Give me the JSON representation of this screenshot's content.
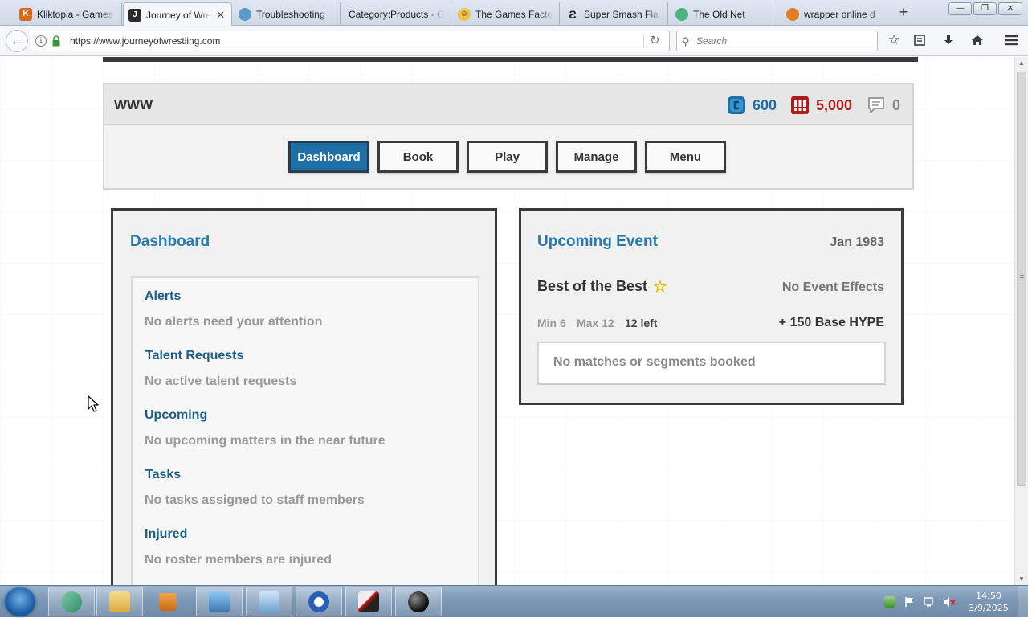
{
  "browser": {
    "tabs": [
      {
        "title": "Kliktopia - Games",
        "favicon": "kliktopia-icon",
        "color": "#d46b1e"
      },
      {
        "title": "Journey of Wrestling",
        "favicon": "jow-icon",
        "color": "#333333",
        "active": true
      },
      {
        "title": "Troubleshooting",
        "favicon": "troubleshooting-icon",
        "color": "#4a86b8"
      },
      {
        "title": "Category:Products - G",
        "favicon": "none",
        "color": "#cccccc"
      },
      {
        "title": "The Games Factory",
        "favicon": "games-factory-icon",
        "color": "#e7a626"
      },
      {
        "title": "Super Smash Flash",
        "favicon": "smash-icon",
        "color": "#222222"
      },
      {
        "title": "The Old Net",
        "favicon": "oldnet-icon",
        "color": "#3a9a6a"
      },
      {
        "title": "wrapper online d",
        "favicon": "wrapper-icon",
        "color": "#e27d2a"
      }
    ],
    "tab_close": "✕",
    "new_tab": "+",
    "url": "https://www.journeyofwrestling.com",
    "url_display": "https://www.journeyofwrestling.com",
    "search_placeholder": "Search"
  },
  "header": {
    "promotion_name": "WWW",
    "stats": {
      "currency_blue": "600",
      "currency_red": "5,000",
      "messages": "0"
    },
    "colors": {
      "blue": "#1e6fa6",
      "red": "#b01c1c",
      "gray": "#888888"
    }
  },
  "nav": {
    "buttons": [
      {
        "label": "Dashboard",
        "active": true
      },
      {
        "label": "Book"
      },
      {
        "label": "Play"
      },
      {
        "label": "Manage"
      },
      {
        "label": "Menu"
      }
    ]
  },
  "dashboard": {
    "title": "Dashboard",
    "items": [
      {
        "title": "Alerts",
        "text": "No alerts need your attention"
      },
      {
        "title": "Talent Requests",
        "text": "No active talent requests"
      },
      {
        "title": "Upcoming",
        "text": "No upcoming matters in the near future"
      },
      {
        "title": "Tasks",
        "text": "No tasks assigned to staff members"
      },
      {
        "title": "Injured",
        "text": "No roster members are injured"
      }
    ]
  },
  "event": {
    "title": "Upcoming Event",
    "date": "Jan 1983",
    "name": "Best of the Best",
    "effects": "No Event Effects",
    "min": "Min 6",
    "max": "Max 12",
    "left": "12 left",
    "hype": "+ 150 Base HYPE",
    "empty_text": "No matches or segments booked"
  },
  "taskbar": {
    "time": "14:50",
    "date": "3/9/2025"
  }
}
